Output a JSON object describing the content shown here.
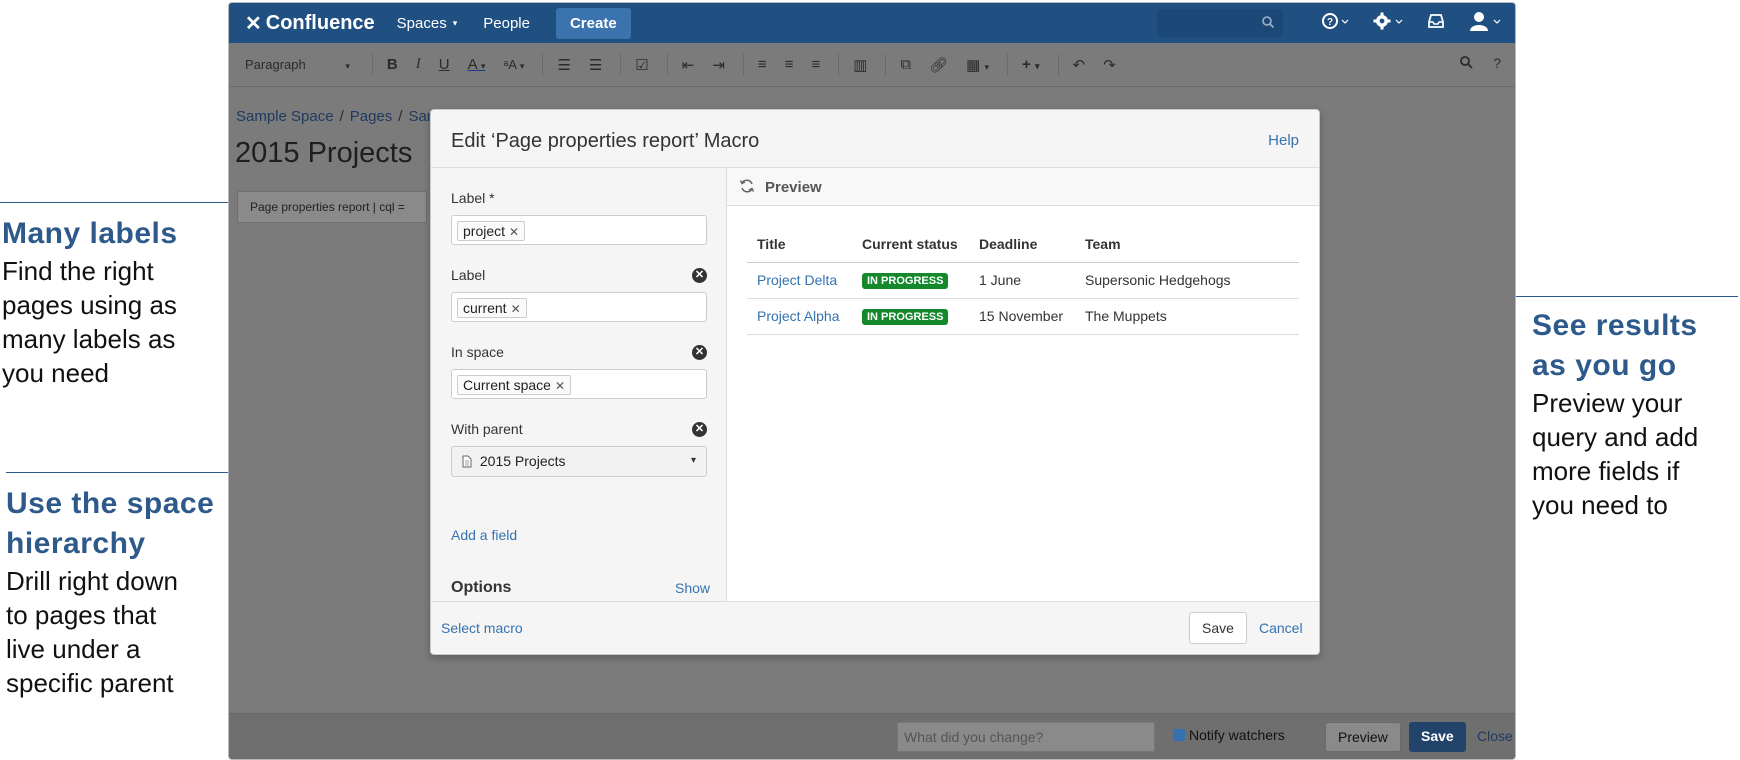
{
  "annotations": {
    "labels": {
      "heading": "Many labels",
      "body": [
        "Find the right",
        "pages using as",
        "many labels as",
        "you need"
      ]
    },
    "hierarchy": {
      "heading": [
        "Use the space",
        "hierarchy"
      ],
      "body": [
        "Drill right down",
        "to pages that",
        "live under a",
        "specific parent"
      ]
    },
    "results": {
      "heading": [
        "See results",
        "as you go"
      ],
      "body": [
        "Preview your",
        "query and add",
        "more fields if",
        "you need to"
      ]
    }
  },
  "topnav": {
    "logo": "Confluence",
    "spaces": "Spaces",
    "people": "People",
    "create": "Create"
  },
  "toolbar": {
    "paragraph": "Paragraph"
  },
  "page": {
    "breadcrumbs": [
      "Sample Space",
      "Pages",
      "Sam"
    ],
    "title": "2015 Projects",
    "macro_placeholder": "Page properties report | cql ="
  },
  "bottombar": {
    "comment_placeholder": "What did you change?",
    "notify": "Notify watchers",
    "preview": "Preview",
    "save": "Save",
    "close": "Close"
  },
  "dialog": {
    "title": "Edit ‘Page properties report’ Macro",
    "help": "Help",
    "fields": [
      {
        "label": "Label *",
        "tag": "project",
        "removable": false
      },
      {
        "label": "Label",
        "tag": "current",
        "removable": true
      },
      {
        "label": "In space",
        "tag": "Current space",
        "removable": true
      },
      {
        "label": "With parent",
        "value": "2015 Projects",
        "removable": true
      }
    ],
    "add_field": "Add a field",
    "options": "Options",
    "show": "Show",
    "preview_label": "Preview",
    "select_macro": "Select macro",
    "save": "Save",
    "cancel": "Cancel"
  },
  "results": {
    "columns": [
      "Title",
      "Current status",
      "Deadline",
      "Team"
    ],
    "rows": [
      {
        "title": "Project Delta",
        "status": "IN PROGRESS",
        "deadline": "1 June",
        "team": "Supersonic Hedgehogs"
      },
      {
        "title": "Project Alpha",
        "status": "IN PROGRESS",
        "deadline": "15 November",
        "team": "The Muppets"
      }
    ]
  },
  "colors": {
    "nav": "#205081",
    "link": "#3572b0",
    "annotation": "#2d5a8a",
    "lozenge": "#14892c"
  }
}
